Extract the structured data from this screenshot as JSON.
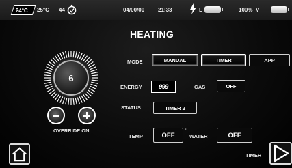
{
  "status_bar": {
    "inside_temp": "24°C",
    "outside_temp": "25°C",
    "humidity": "44",
    "date": "04/00/00",
    "time": "21:33",
    "power_label": "L",
    "battery_percent": "100%",
    "voltage_label": "V"
  },
  "page_title": "HEATING",
  "dial": {
    "value": "6"
  },
  "override_label": "OVERRIDE ON",
  "mode": {
    "label": "MODE",
    "options": [
      "MANUAL",
      "TIMER",
      "APP"
    ],
    "selected": [
      "MANUAL",
      "TIMER"
    ]
  },
  "energy": {
    "label": "ENERGY",
    "value": "999"
  },
  "gas": {
    "label": "GAS",
    "value": "OFF"
  },
  "status": {
    "label": "STATUS",
    "value": "TIMER 2"
  },
  "temp": {
    "label": "TEMP",
    "value": "OFF"
  },
  "separator": "-",
  "water": {
    "label": "WATER",
    "value": "OFF"
  },
  "nav": {
    "next_label": "TIMER"
  },
  "icons": {
    "humidity": "water-drop-icon",
    "power": "lightning-plug-icon",
    "battery": "battery-icon",
    "home": "home-icon",
    "next": "play-arrow-icon"
  }
}
